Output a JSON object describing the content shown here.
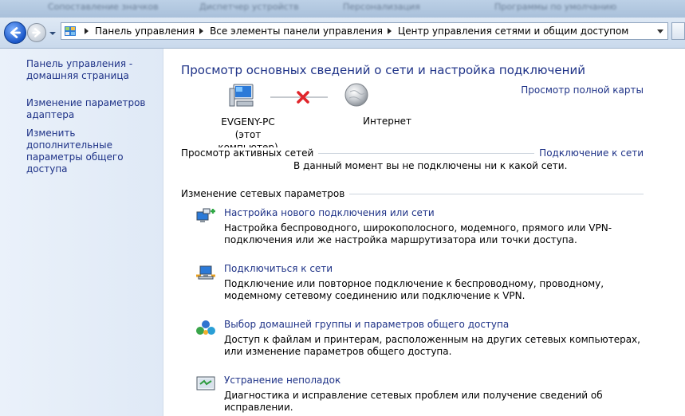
{
  "tabs": [
    "Сопоставление значков",
    "Диспетчер устройств",
    "Персонализация",
    "Программы по умолчанию"
  ],
  "breadcrumb": [
    "Панель управления",
    "Все элементы панели управления",
    "Центр управления сетями и общим доступом"
  ],
  "sidebar": {
    "items": [
      {
        "label": "Панель управления - домашняя страница"
      },
      {
        "label": "Изменение параметров адаптера"
      },
      {
        "label": "Изменить дополнительные параметры общего доступа"
      }
    ]
  },
  "main": {
    "title": "Просмотр основных сведений о сети и настройка подключений",
    "full_map_link": "Просмотр полной карты",
    "computer_name": "EVGENY-PC",
    "computer_sub": "(этот компьютер)",
    "internet_label": "Интернет",
    "active_networks": {
      "label": "Просмотр активных сетей",
      "connect_link": "Подключение к сети",
      "status": "В данный момент вы не подключены ни к какой сети."
    },
    "change_settings_label": "Изменение сетевых параметров",
    "tasks": [
      {
        "link": "Настройка нового подключения или сети",
        "description": "Настройка беспроводного, широкополосного, модемного, прямого или VPN-подключения или же настройка маршрутизатора или точки доступа.",
        "icon": "new-connection-icon"
      },
      {
        "link": "Подключиться к сети",
        "description": "Подключение или повторное подключение к беспроводному, проводному, модемному сетевому соединению или подключение к VPN.",
        "icon": "connect-network-icon"
      },
      {
        "link": "Выбор домашней группы и параметров общего доступа",
        "description": "Доступ к файлам и принтерам, расположенным на других сетевых компьютерах, или изменение параметров общего доступа.",
        "icon": "homegroup-icon"
      },
      {
        "link": "Устранение неполадок",
        "description": "Диагностика и исправление сетевых проблем или получение сведений об исправлении.",
        "icon": "troubleshoot-icon"
      }
    ]
  },
  "colors": {
    "link": "#1e3287",
    "sidebar_bg": "#e3ecf8",
    "error_x": "#e0242a"
  }
}
